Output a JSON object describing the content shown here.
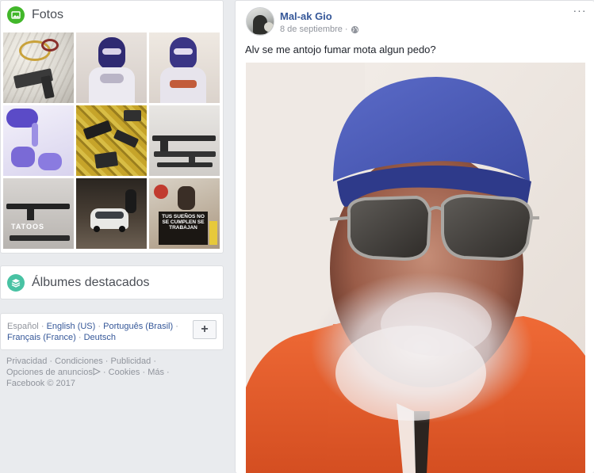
{
  "photos_card": {
    "title": "Fotos",
    "icon": "photos-icon",
    "thumbnails": [
      {
        "name": "photo-thumb-jewelry-pistol"
      },
      {
        "name": "photo-thumb-masked-man"
      },
      {
        "name": "photo-thumb-masked-man-2"
      },
      {
        "name": "photo-thumb-gloved-hands"
      },
      {
        "name": "photo-thumb-pistols-on-blanket"
      },
      {
        "name": "photo-thumb-rifles-on-table"
      },
      {
        "name": "photo-thumb-rifles-tatoos"
      },
      {
        "name": "photo-thumb-white-car"
      },
      {
        "name": "photo-thumb-poster"
      }
    ]
  },
  "albums_card": {
    "title": "Álbumes destacados",
    "icon": "albums-icon"
  },
  "language": {
    "current": "Español",
    "links": [
      "English (US)",
      "Português (Brasil)",
      "Français (France)",
      "Deutsch"
    ],
    "separator": "·",
    "add_label": "+"
  },
  "footer": {
    "line1": [
      "Privacidad",
      "Condiciones",
      "Publicidad"
    ],
    "ads_options": "Opciones de anuncios",
    "line2_rest": [
      "Cookies",
      "Más"
    ],
    "copyright": "Facebook © 2017",
    "separator": "·"
  },
  "post": {
    "author": "Mal-ak Gio",
    "date": "8 de septiembre",
    "date_separator": "·",
    "privacy_icon": "globe-icon",
    "more_label": "···",
    "text": "Alv se me antojo fumar mota algun pedo?",
    "photo_overlay": {
      "poster_text": "TUS SUEÑOS NO SE CUMPLEN SE TRABAJAN"
    }
  },
  "thumb_caption": "TATOOS",
  "colors": {
    "page_bg": "#e9ebee",
    "link": "#365899",
    "muted": "#90949c",
    "photos_icon": "#42b72a",
    "albums_icon": "#48c2a3",
    "jacket": "#e35a2a",
    "cap": "#4a5bb5"
  }
}
